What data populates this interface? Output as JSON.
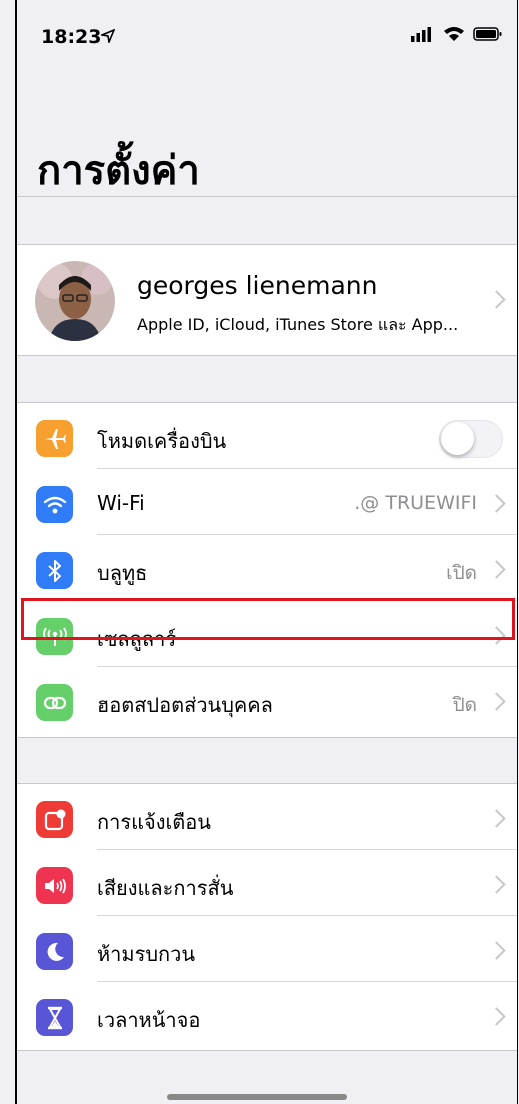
{
  "status_bar": {
    "time": "18:23"
  },
  "page_title": "การตั้งค่า",
  "profile": {
    "name": "georges lienemann",
    "subtitle": "Apple ID, iCloud, iTunes Store และ App..."
  },
  "connectivity": [
    {
      "label": "โหมดเครื่องบิน",
      "value": "",
      "icon": "airplane-icon",
      "color": "#f7a030",
      "toggle": false
    },
    {
      "label": "Wi-Fi",
      "value": ".@ TRUEWIFI",
      "icon": "wifi-icon",
      "color": "#2f7cf6"
    },
    {
      "label": "บลูทูธ",
      "value": "เปิด",
      "icon": "bluetooth-icon",
      "color": "#2f7cf6"
    },
    {
      "label": "เซลลูลาร์",
      "value": "",
      "icon": "cellular-icon",
      "color": "#65cf6a"
    },
    {
      "label": "ฮอตสปอตส่วนบุคคล",
      "value": "ปิด",
      "icon": "hotspot-icon",
      "color": "#65cf6a"
    }
  ],
  "notifications": [
    {
      "label": "การแจ้งเตือน",
      "icon": "notifications-icon",
      "color": "#ee3b35"
    },
    {
      "label": "เสียงและการสั่น",
      "icon": "sound-icon",
      "color": "#ee3450"
    },
    {
      "label": "ห้ามรบกวน",
      "icon": "moon-icon",
      "color": "#5856d6"
    },
    {
      "label": "เวลาหน้าจอ",
      "icon": "hourglass-icon",
      "color": "#5856d6"
    }
  ]
}
